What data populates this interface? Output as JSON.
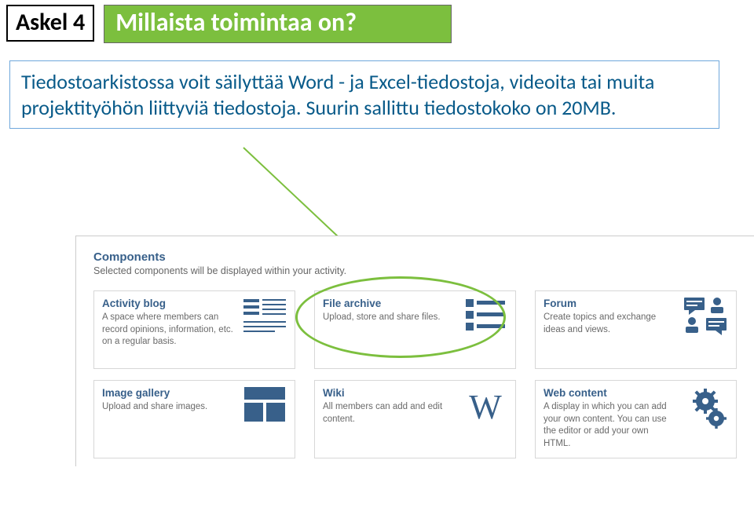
{
  "header": {
    "step_label": "Askel 4",
    "title": "Millaista toimintaa on?"
  },
  "description": "Tiedostoarkistossa voit säilyttää Word - ja Excel-tiedostoja, videoita tai muita projektityöhön liittyviä tiedostoja. Suurin sallittu tiedostokoko on 20MB.",
  "panel": {
    "heading": "Components",
    "subheading": "Selected components will be displayed within your activity."
  },
  "components": [
    {
      "id": "activity-blog",
      "title": "Activity blog",
      "desc": "A space where members can record opinions, information, etc. on a regular basis."
    },
    {
      "id": "file-archive",
      "title": "File archive",
      "desc": "Upload, store and share files."
    },
    {
      "id": "forum",
      "title": "Forum",
      "desc": "Create topics and exchange ideas and views."
    },
    {
      "id": "image-gallery",
      "title": "Image gallery",
      "desc": "Upload and share images."
    },
    {
      "id": "wiki",
      "title": "Wiki",
      "desc": "All members can add and edit content."
    },
    {
      "id": "web-content",
      "title": "Web content",
      "desc": "A display in which you can add your own content. You can use the editor or add your own HTML."
    }
  ],
  "highlight_target": "file-archive"
}
